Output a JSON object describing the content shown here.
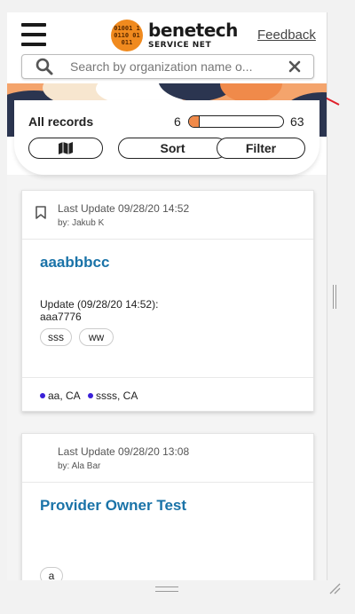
{
  "header": {
    "logo_glyphs": "01001 10110 01011",
    "logo_main": "benetech",
    "logo_sub": "SERVICE NET",
    "feedback_label": "Feedback"
  },
  "search": {
    "placeholder": "Search by organization name o...",
    "value": ""
  },
  "controls": {
    "title": "All records",
    "range_min": "6",
    "range_max": "63",
    "slider_fill_fraction": 0.1,
    "sort_label": "Sort",
    "filter_label": "Filter"
  },
  "colors": {
    "accent_orange": "#f08a4a",
    "title_blue": "#1a73a8",
    "location_dot": "#3a20d8",
    "annotation_arrow": "#e0202a"
  },
  "cards": [
    {
      "updated": "Last Update 09/28/20 14:52",
      "by": "by: Jakub K",
      "title": "aaabbbcc",
      "update_line1": "Update (09/28/20 14:52):",
      "update_line2": "aaa7776",
      "tags": [
        "sss",
        "ww"
      ],
      "locations": [
        "aa, CA",
        "ssss, CA"
      ]
    },
    {
      "updated": "Last Update 09/28/20 13:08",
      "by": "by: Ala Bar",
      "title": "Provider Owner Test",
      "tags": [
        "a"
      ]
    }
  ]
}
